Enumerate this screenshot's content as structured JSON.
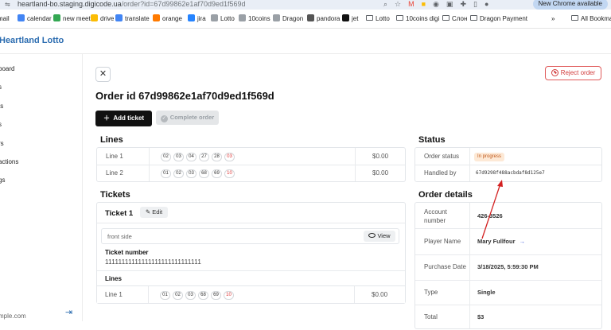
{
  "browser": {
    "url_host": "heartland-bo.staging.digicode.ua",
    "url_path": "/order?id=67d99862e1af70d9ed1f569d",
    "update_label": "New Chrome available",
    "bookmarks": [
      {
        "label": "mail",
        "color": "#ea4335"
      },
      {
        "label": "calendar",
        "color": "#4285f4"
      },
      {
        "label": "new meet",
        "color": "#34a853"
      },
      {
        "label": "drive",
        "color": "#fbbc04"
      },
      {
        "label": "translate",
        "color": "#4285f4"
      },
      {
        "label": "orange",
        "color": "#ff7a00"
      },
      {
        "label": "jira",
        "color": "#2684ff"
      },
      {
        "label": "Lotto",
        "color": "#9aa0a6"
      },
      {
        "label": "10coins",
        "color": "#9aa0a6"
      },
      {
        "label": "Dragon",
        "color": "#9aa0a6"
      },
      {
        "label": "pandora",
        "color": "#555555"
      },
      {
        "label": "jet",
        "color": "#111111"
      },
      {
        "label": "Lotto",
        "color": "folder"
      },
      {
        "label": "10coins digi",
        "color": "folder"
      },
      {
        "label": "Слон",
        "color": "folder"
      },
      {
        "label": "Dragon Payment",
        "color": "folder"
      },
      {
        "label": "All Bookmark",
        "color": "folder"
      }
    ]
  },
  "app": {
    "brand": "Heartland Lotto"
  },
  "sidebar": {
    "items": [
      "board",
      "s",
      "ts",
      "s",
      "rs",
      "actions",
      "gs"
    ],
    "footer": "mple.com"
  },
  "order": {
    "reject_label": "Reject order",
    "title": "Order id 67d99862e1af70d9ed1f569d",
    "add_ticket_label": "Add ticket",
    "complete_order_label": "Complete order"
  },
  "lines": {
    "heading": "Lines",
    "rows": [
      {
        "label": "Line 1",
        "balls": [
          "02",
          "03",
          "04",
          "27",
          "28"
        ],
        "special": "03",
        "price": "$0.00"
      },
      {
        "label": "Line 2",
        "balls": [
          "01",
          "02",
          "03",
          "68",
          "69"
        ],
        "special": "10",
        "price": "$0.00"
      }
    ]
  },
  "tickets": {
    "heading": "Tickets",
    "ticket_name": "Ticket 1",
    "edit_label": "Edit",
    "front_side_label": "front side",
    "view_label": "View",
    "ticket_number_label": "Ticket number",
    "ticket_number_value": "11111111111111111111111111111",
    "lines_label": "Lines",
    "line": {
      "label": "Line 1",
      "balls": [
        "01",
        "02",
        "03",
        "68",
        "69"
      ],
      "special": "10",
      "price": "$0.00"
    }
  },
  "status": {
    "heading": "Status",
    "order_status_label": "Order status",
    "order_status_value": "In progress",
    "handled_by_label": "Handled by",
    "handled_by_value": "67d9298f488acbdaf8d125e7"
  },
  "order_details": {
    "heading": "Order details",
    "rows": [
      {
        "label": "Account number",
        "value": "426-3526"
      },
      {
        "label": "Player Name",
        "value": "Mary Fullfour"
      },
      {
        "label": "Purchase Date",
        "value": "3/18/2025, 5:59:30 PM"
      },
      {
        "label": "Type",
        "value": "Single"
      },
      {
        "label": "Total",
        "value": "$3"
      }
    ]
  },
  "colors": {
    "brand": "#2b6cb0",
    "reject": "#d13b3b",
    "status_pill_bg": "#fde9d6",
    "special_ball": "#dd3333",
    "annotation_arrow": "#d32020"
  }
}
